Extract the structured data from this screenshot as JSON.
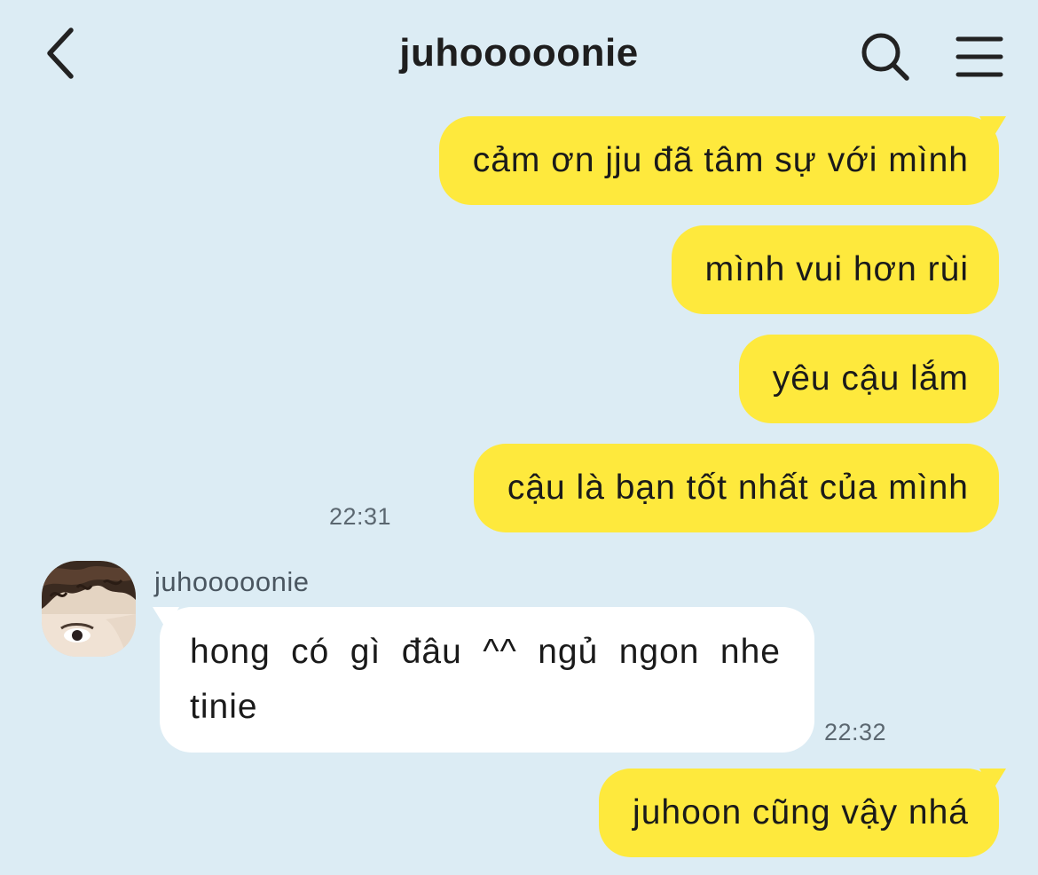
{
  "header": {
    "title": "juhooooonie",
    "back_icon": "chevron-left-icon",
    "search_icon": "search-icon",
    "menu_icon": "hamburger-menu-icon"
  },
  "messages": {
    "m1": {
      "text": "cảm ơn jju đã tâm sự với mình"
    },
    "m2": {
      "text": "mình vui hơn rùi"
    },
    "m3": {
      "text": "yêu cậu lắm"
    },
    "m4": {
      "text": "cậu là bạn tốt nhất của mình",
      "time": "22:31"
    },
    "m5": {
      "sender": "juhooooonie",
      "text": "hong có gì đâu ^^ ngủ ngon nhe tinie",
      "time": "22:32"
    },
    "m6": {
      "text": "juhoon cũng vậy nhá"
    }
  },
  "colors": {
    "background": "#dcecf4",
    "my_bubble": "#fee93d",
    "their_bubble": "#ffffff",
    "text": "#1a1a1a",
    "time_text": "#5b6770"
  }
}
